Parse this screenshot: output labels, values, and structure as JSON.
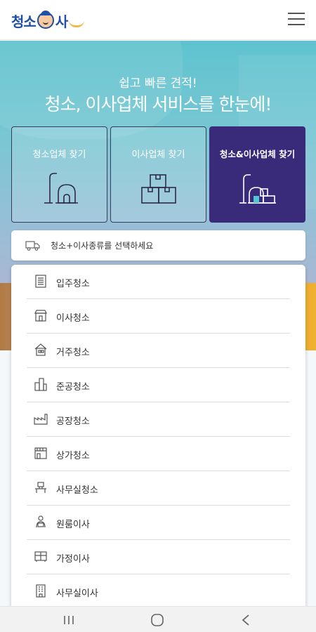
{
  "header": {
    "logo_text_main": "청소",
    "logo_text_end": "사",
    "logo_text_small": "이",
    "menu_icon": "hamburger-menu-icon"
  },
  "hero": {
    "subtitle": "쉽고 빠른 견적!",
    "title": "청소, 이사업체 서비스를 한눈에!"
  },
  "cards": [
    {
      "label": "청소업체 찾기",
      "icon": "vacuum-cleaner-icon",
      "active": false
    },
    {
      "label": "이사업체 찾기",
      "icon": "moving-boxes-icon",
      "active": false
    },
    {
      "label": "청소&이사업체 찾기",
      "icon": "cleaning-and-moving-icon",
      "active": true
    }
  ],
  "select": {
    "placeholder": "청소+이사종류를 선택하세요",
    "icon": "truck-icon"
  },
  "dropdown_items": [
    {
      "label": "입주청소",
      "icon": "building-icon"
    },
    {
      "label": "이사청소",
      "icon": "store-icon"
    },
    {
      "label": "거주청소",
      "icon": "house-icon"
    },
    {
      "label": "준공청소",
      "icon": "city-buildings-icon"
    },
    {
      "label": "공장청소",
      "icon": "factory-icon"
    },
    {
      "label": "상가청소",
      "icon": "shop-icon"
    },
    {
      "label": "사무실청소",
      "icon": "office-desk-icon"
    },
    {
      "label": "원룸이사",
      "icon": "moving-person-icon"
    },
    {
      "label": "가정이사",
      "icon": "home-furniture-icon"
    },
    {
      "label": "사무실이사",
      "icon": "office-building-icon"
    }
  ],
  "navbar": {
    "recent_icon": "recent-apps-icon",
    "home_icon": "home-button-icon",
    "back_icon": "back-icon"
  },
  "colors": {
    "active_card": "#3a2a7a",
    "hero_top": "#5ec3cf",
    "logo_blue": "#1f4fa8"
  }
}
